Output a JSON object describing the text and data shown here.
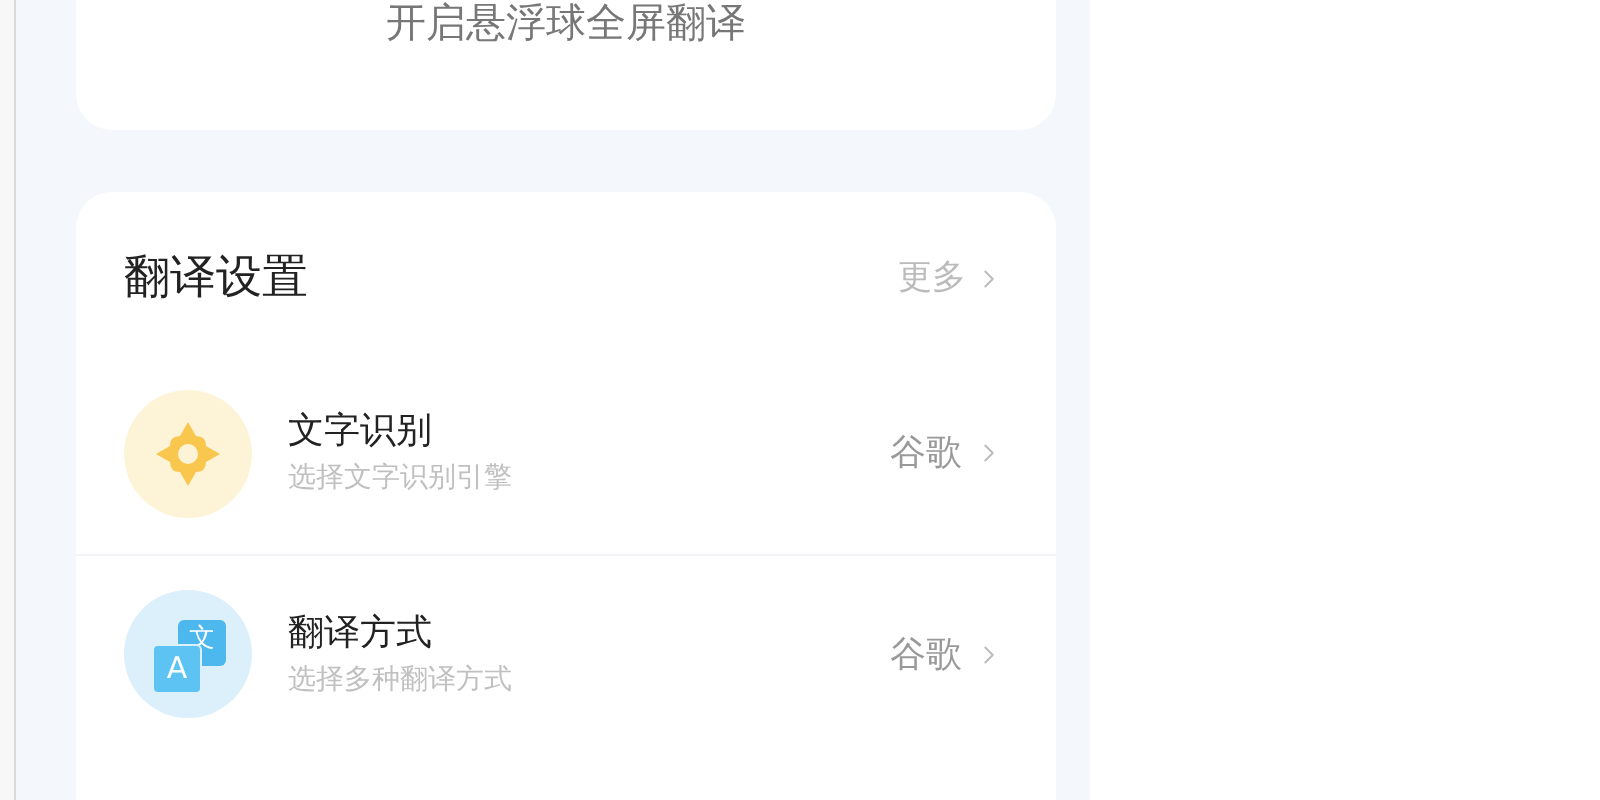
{
  "floating_card": {
    "text": "开启悬浮球全屏翻译"
  },
  "settings": {
    "title": "翻译设置",
    "more": "更多",
    "items": [
      {
        "kind": "ocr",
        "title": "文字识别",
        "subtitle": "选择文字识别引擎",
        "value": "谷歌"
      },
      {
        "kind": "translate",
        "title": "翻译方式",
        "subtitle": "选择多种翻译方式",
        "value": "谷歌",
        "icon_letters": [
          "A",
          "文"
        ]
      }
    ]
  }
}
